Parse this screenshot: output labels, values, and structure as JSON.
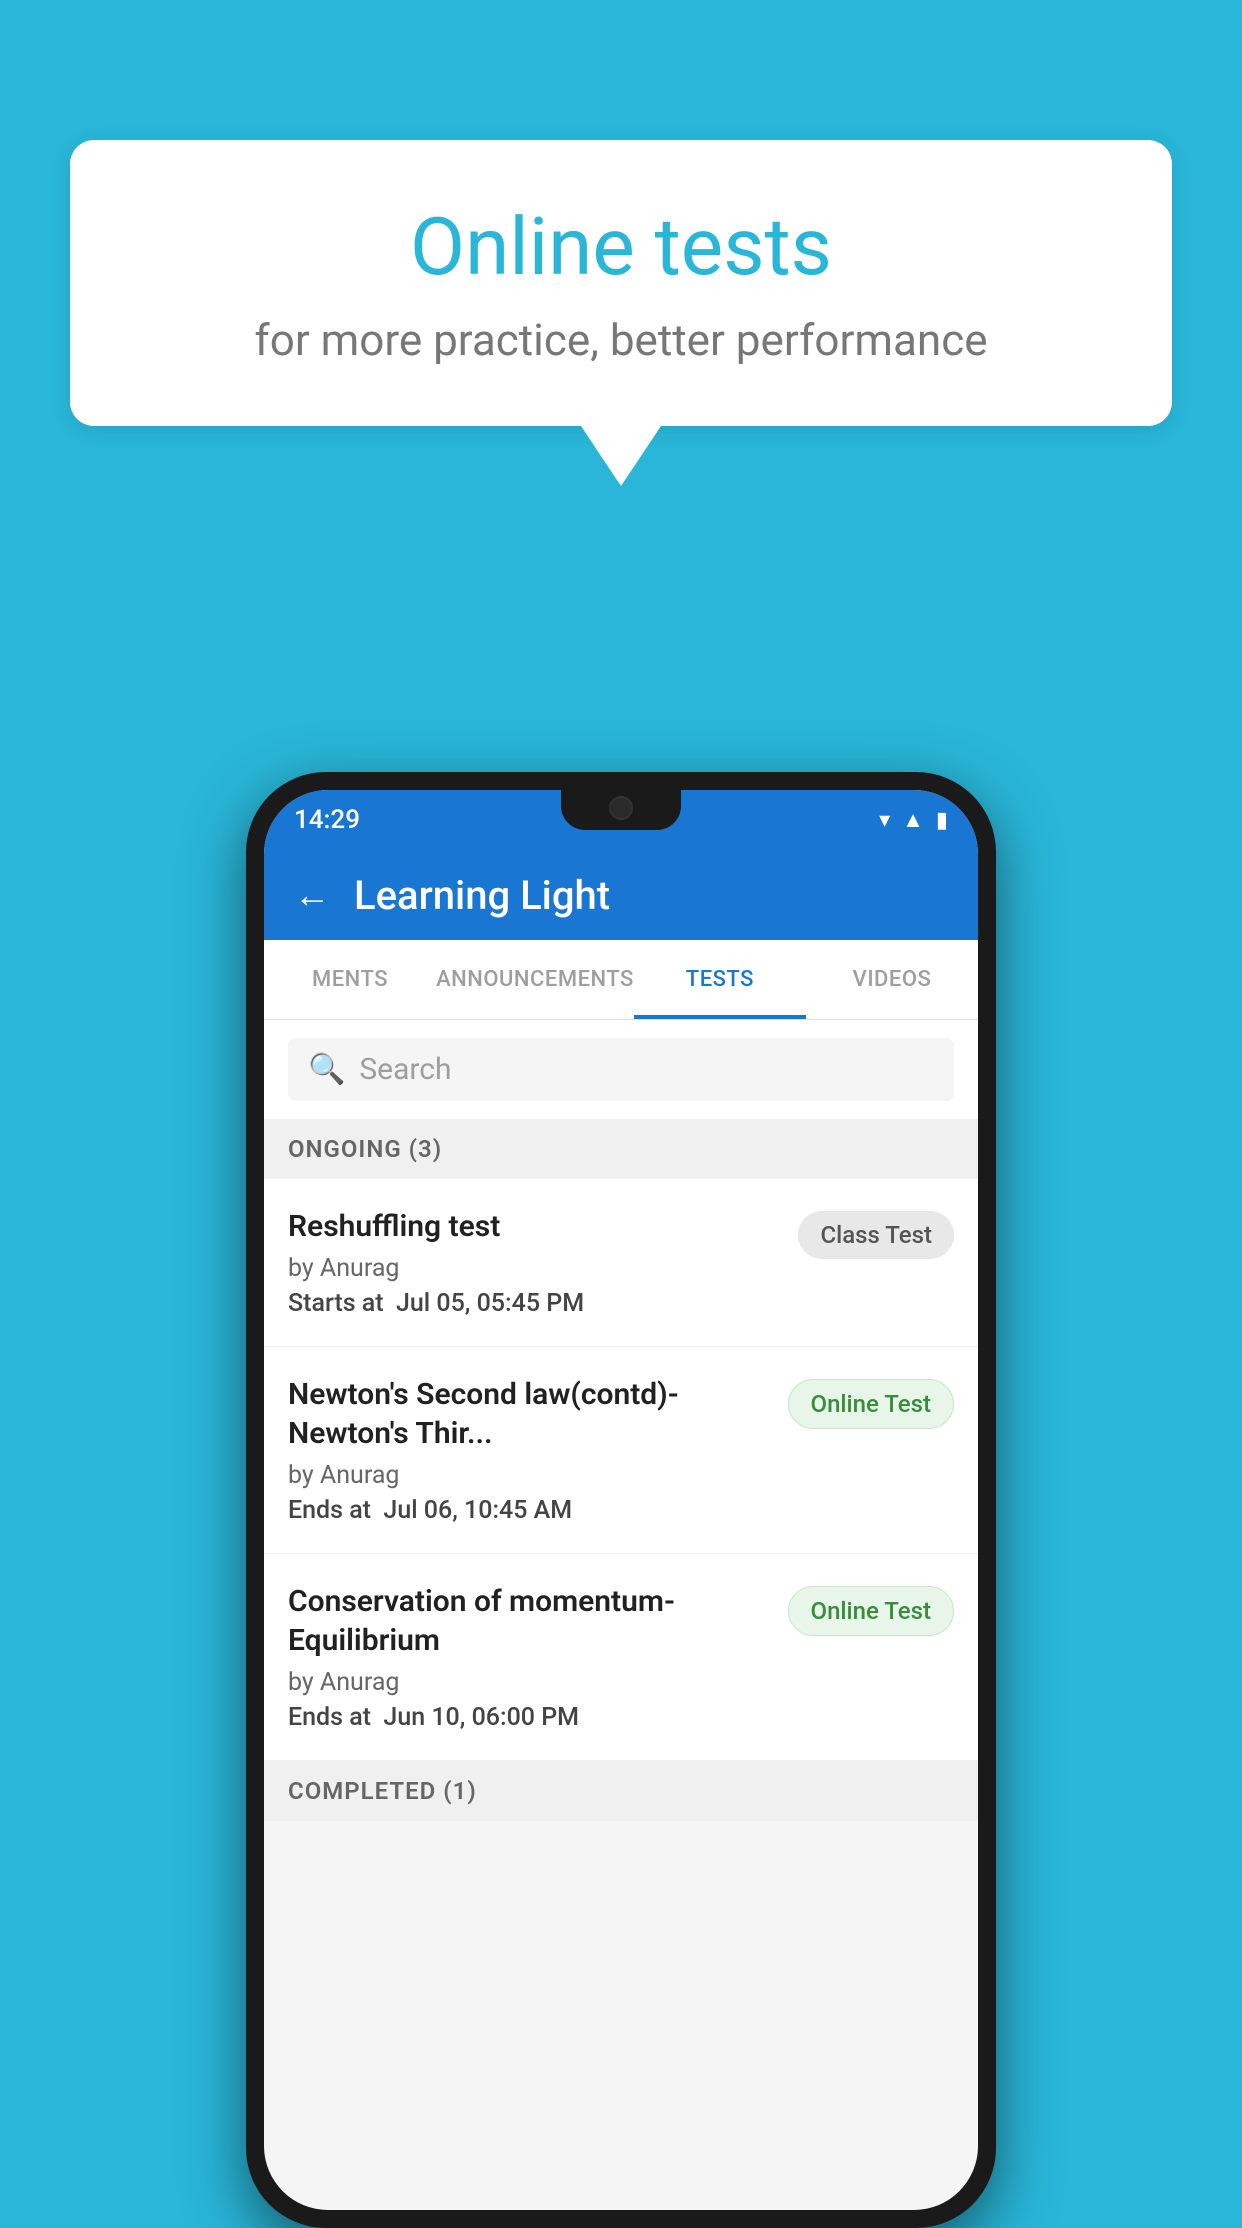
{
  "background": {
    "color": "#29B6D8"
  },
  "speech_bubble": {
    "title": "Online tests",
    "subtitle": "for more practice, better performance"
  },
  "phone": {
    "status_bar": {
      "time": "14:29",
      "icons": [
        "wifi",
        "signal",
        "battery"
      ]
    },
    "app_bar": {
      "title": "Learning Light",
      "back_label": "←"
    },
    "tabs": [
      {
        "label": "MENTS",
        "active": false
      },
      {
        "label": "ANNOUNCEMENTS",
        "active": false
      },
      {
        "label": "TESTS",
        "active": true
      },
      {
        "label": "VIDEOS",
        "active": false
      }
    ],
    "search": {
      "placeholder": "Search"
    },
    "section_ongoing": {
      "label": "ONGOING (3)"
    },
    "tests": [
      {
        "title": "Reshuffling test",
        "author": "by Anurag",
        "date_label": "Starts at",
        "date": "Jul 05, 05:45 PM",
        "badge": "Class Test",
        "badge_type": "class"
      },
      {
        "title": "Newton's Second law(contd)-Newton's Thir...",
        "author": "by Anurag",
        "date_label": "Ends at",
        "date": "Jul 06, 10:45 AM",
        "badge": "Online Test",
        "badge_type": "online"
      },
      {
        "title": "Conservation of momentum-Equilibrium",
        "author": "by Anurag",
        "date_label": "Ends at",
        "date": "Jun 10, 06:00 PM",
        "badge": "Online Test",
        "badge_type": "online"
      }
    ],
    "section_completed": {
      "label": "COMPLETED (1)"
    }
  }
}
